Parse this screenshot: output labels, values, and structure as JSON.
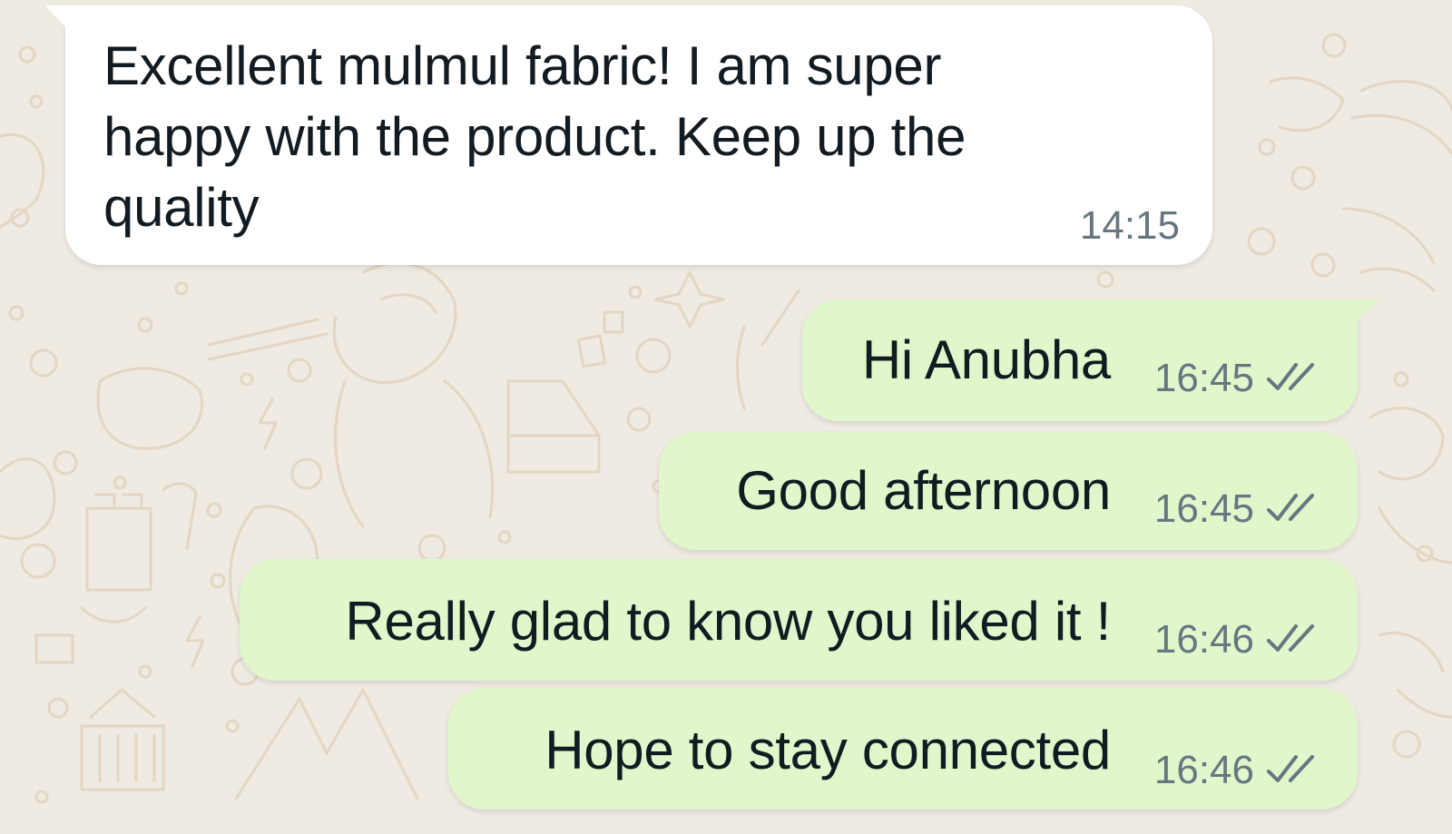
{
  "chat": {
    "messages": [
      {
        "direction": "incoming",
        "text": "Excellent mulmul fabric! I am super happy with the product. Keep up the quality",
        "time": "14:15"
      },
      {
        "direction": "outgoing",
        "text": "Hi Anubha",
        "time": "16:45",
        "status_icon": "double-check-icon"
      },
      {
        "direction": "outgoing",
        "text": "Good afternoon",
        "time": "16:45",
        "status_icon": "double-check-icon"
      },
      {
        "direction": "outgoing",
        "text": "Really glad to know you liked it !",
        "time": "16:46",
        "status_icon": "double-check-icon"
      },
      {
        "direction": "outgoing",
        "text": "Hope to stay connected",
        "time": "16:46",
        "status_icon": "double-check-icon"
      }
    ]
  },
  "colors": {
    "background": "#efeae2",
    "incoming_bubble": "#ffffff",
    "outgoing_bubble": "#e1f6cb",
    "text": "#111b21",
    "meta_text": "#667781"
  }
}
